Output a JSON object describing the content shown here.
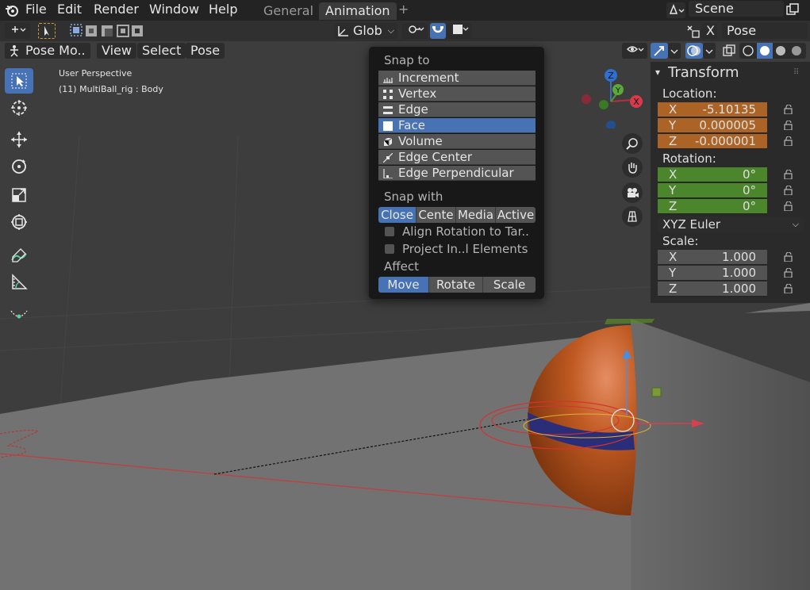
{
  "menu": [
    "File",
    "Edit",
    "Render",
    "Window",
    "Help"
  ],
  "workspaces": [
    {
      "label": "General"
    },
    {
      "label": "Animation"
    }
  ],
  "add_workspace": "+",
  "scene": "Scene",
  "header": {
    "orientation": "Glob",
    "pose_options": "Pose Options",
    "close_x": "X"
  },
  "viewport_header": {
    "mode": "Pose Mo..",
    "menus": [
      "View",
      "Select",
      "Pose"
    ]
  },
  "viewport": {
    "perspective": "User Perspective",
    "object_info": "(11) MultiBall_rig : Body"
  },
  "snap_popup": {
    "snap_to_title": "Snap to",
    "snap_to_items": [
      "Increment",
      "Vertex",
      "Edge",
      "Face",
      "Volume",
      "Edge Center",
      "Edge Perpendicular"
    ],
    "snap_to_selected": "Face",
    "snap_with_title": "Snap with",
    "snap_with_options": [
      "Close",
      "Cente",
      "Media",
      "Active"
    ],
    "snap_with_selected": "Close",
    "align_rotation": "Align Rotation to Tar..",
    "project_elements": "Project In..l Elements",
    "affect_title": "Affect",
    "affect_options": [
      "Move",
      "Rotate",
      "Scale"
    ],
    "affect_selected": "Move"
  },
  "transform": {
    "title": "Transform",
    "location_label": "Location:",
    "location": [
      {
        "axis": "X",
        "value": "-5.10135"
      },
      {
        "axis": "Y",
        "value": "0.000005"
      },
      {
        "axis": "Z",
        "value": "-0.000001"
      }
    ],
    "rotation_label": "Rotation:",
    "rotation": [
      {
        "axis": "X",
        "value": "0°"
      },
      {
        "axis": "Y",
        "value": "0°"
      },
      {
        "axis": "Z",
        "value": "0°"
      }
    ],
    "rotation_mode": "XYZ Euler",
    "scale_label": "Scale:",
    "scale": [
      {
        "axis": "X",
        "value": "1.000"
      },
      {
        "axis": "Y",
        "value": "1.000"
      },
      {
        "axis": "Z",
        "value": "1.000"
      }
    ]
  },
  "gizmo": {
    "z": "Z",
    "y": "Y",
    "x": "X"
  },
  "colors": {
    "accent": "#4772b3",
    "location": "#b06625",
    "rotation": "#4d8a2c"
  }
}
